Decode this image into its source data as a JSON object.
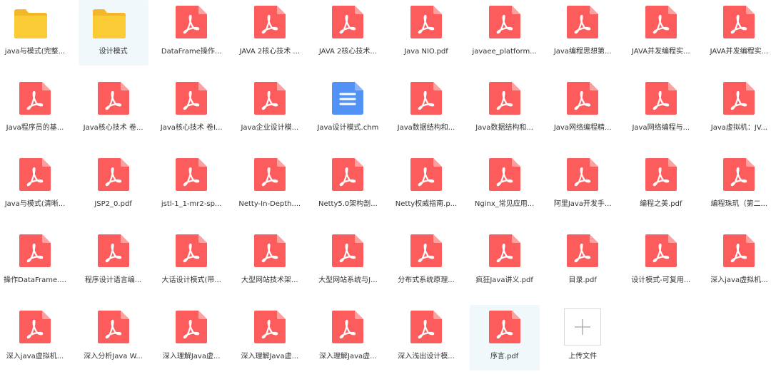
{
  "colors": {
    "pdf": "#fd5c5c",
    "pdf_fold": "#fda0a0",
    "folder": "#fbcb36",
    "folder_tab": "#f4b72a",
    "chm": "#5392f5",
    "selected_bg": "#f1f8fc",
    "text": "#333333"
  },
  "files": [
    {
      "name": "java与模式(完整...",
      "type": "folder",
      "icon": "folder-icon"
    },
    {
      "name": "设计模式",
      "type": "folder",
      "icon": "folder-icon",
      "highlight": true
    },
    {
      "name": "DataFrame操作...",
      "type": "pdf",
      "icon": "pdf-icon"
    },
    {
      "name": "JAVA 2核心技术 ...",
      "type": "pdf",
      "icon": "pdf-icon"
    },
    {
      "name": "JAVA 2核心技术...",
      "type": "pdf",
      "icon": "pdf-icon"
    },
    {
      "name": "Java NIO.pdf",
      "type": "pdf",
      "icon": "pdf-icon"
    },
    {
      "name": "javaee_platform...",
      "type": "pdf",
      "icon": "pdf-icon"
    },
    {
      "name": "Java编程思想第...",
      "type": "pdf",
      "icon": "pdf-icon"
    },
    {
      "name": "JAVA并发编程实...",
      "type": "pdf",
      "icon": "pdf-icon"
    },
    {
      "name": "JAVA并发编程实...",
      "type": "pdf",
      "icon": "pdf-icon"
    },
    {
      "name": "Java程序员的基...",
      "type": "pdf",
      "icon": "pdf-icon"
    },
    {
      "name": "Java核心技术 卷...",
      "type": "pdf",
      "icon": "pdf-icon"
    },
    {
      "name": "Java核心技术 卷I...",
      "type": "pdf",
      "icon": "pdf-icon"
    },
    {
      "name": "Java企业设计模...",
      "type": "pdf",
      "icon": "pdf-icon"
    },
    {
      "name": "Java设计模式.chm",
      "type": "chm",
      "icon": "document-icon"
    },
    {
      "name": "Java数据结构和...",
      "type": "pdf",
      "icon": "pdf-icon"
    },
    {
      "name": "Java数据结构和...",
      "type": "pdf",
      "icon": "pdf-icon"
    },
    {
      "name": "Java网络编程精...",
      "type": "pdf",
      "icon": "pdf-icon"
    },
    {
      "name": "Java网络编程与...",
      "type": "pdf",
      "icon": "pdf-icon"
    },
    {
      "name": "Java虚拟机：JV...",
      "type": "pdf",
      "icon": "pdf-icon"
    },
    {
      "name": "Java与模式(清晰...",
      "type": "pdf",
      "icon": "pdf-icon"
    },
    {
      "name": "JSP2_0.pdf",
      "type": "pdf",
      "icon": "pdf-icon"
    },
    {
      "name": "jstl-1_1-mr2-sp...",
      "type": "pdf",
      "icon": "pdf-icon"
    },
    {
      "name": "Netty-In-Depth....",
      "type": "pdf",
      "icon": "pdf-icon"
    },
    {
      "name": "Netty5.0架构剖...",
      "type": "pdf",
      "icon": "pdf-icon"
    },
    {
      "name": "Netty权威指南.p...",
      "type": "pdf",
      "icon": "pdf-icon"
    },
    {
      "name": "Nginx_常见应用...",
      "type": "pdf",
      "icon": "pdf-icon"
    },
    {
      "name": "阿里Java开发手...",
      "type": "pdf",
      "icon": "pdf-icon"
    },
    {
      "name": "编程之美.pdf",
      "type": "pdf",
      "icon": "pdf-icon"
    },
    {
      "name": "编程珠玑（第二...",
      "type": "pdf",
      "icon": "pdf-icon"
    },
    {
      "name": "操作DataFrame....",
      "type": "pdf",
      "icon": "pdf-icon"
    },
    {
      "name": "程序设计语言编...",
      "type": "pdf",
      "icon": "pdf-icon"
    },
    {
      "name": "大话设计模式(带...",
      "type": "pdf",
      "icon": "pdf-icon"
    },
    {
      "name": "大型网站技术架...",
      "type": "pdf",
      "icon": "pdf-icon"
    },
    {
      "name": "大型网站系统与J...",
      "type": "pdf",
      "icon": "pdf-icon"
    },
    {
      "name": "分布式系统原理...",
      "type": "pdf",
      "icon": "pdf-icon"
    },
    {
      "name": "疯狂Java讲义.pdf",
      "type": "pdf",
      "icon": "pdf-icon"
    },
    {
      "name": "目录.pdf",
      "type": "pdf",
      "icon": "pdf-icon"
    },
    {
      "name": "设计模式-可复用...",
      "type": "pdf",
      "icon": "pdf-icon"
    },
    {
      "name": "深入java虚拟机...",
      "type": "pdf",
      "icon": "pdf-icon"
    },
    {
      "name": "深入java虚拟机...",
      "type": "pdf",
      "icon": "pdf-icon"
    },
    {
      "name": "深入分析Java W...",
      "type": "pdf",
      "icon": "pdf-icon"
    },
    {
      "name": "深入理解Java虚...",
      "type": "pdf",
      "icon": "pdf-icon"
    },
    {
      "name": "深入理解Java虚...",
      "type": "pdf",
      "icon": "pdf-icon"
    },
    {
      "name": "深入理解Java虚...",
      "type": "pdf",
      "icon": "pdf-icon"
    },
    {
      "name": "深入浅出设计模...",
      "type": "pdf",
      "icon": "pdf-icon"
    },
    {
      "name": "序言.pdf",
      "type": "pdf",
      "icon": "pdf-icon",
      "highlight": true
    },
    {
      "name": "上传文件",
      "type": "upload",
      "icon": "plus-icon"
    }
  ]
}
